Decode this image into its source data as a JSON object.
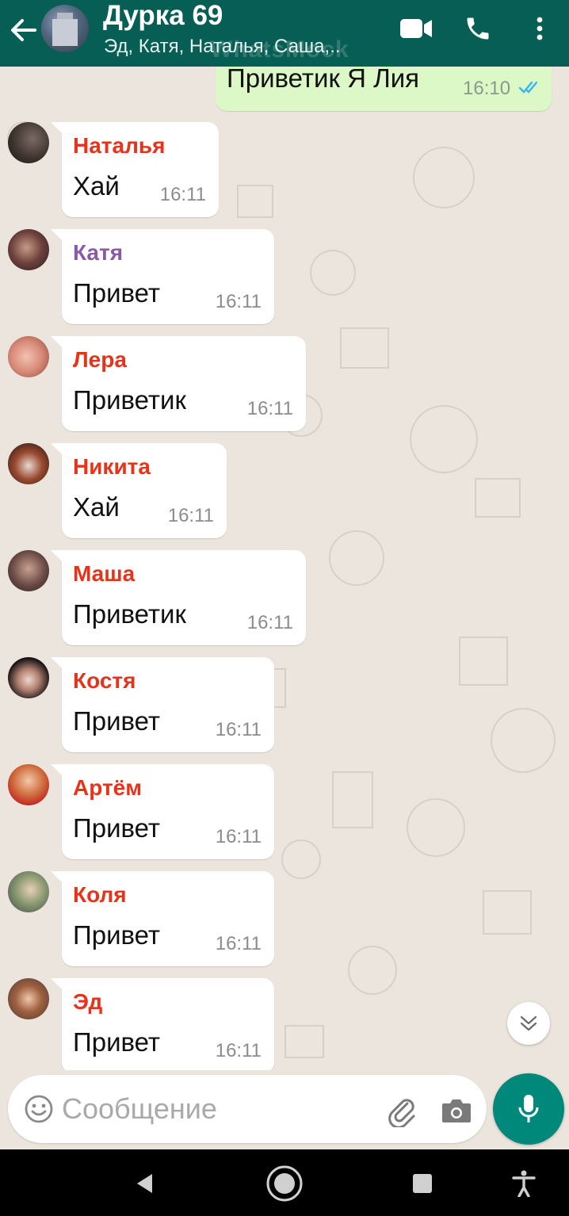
{
  "header": {
    "title": "Дурка 69",
    "subtitle": "Эд, Катя, Наталья, Саша,..",
    "watermark": "WhatsMock",
    "back_icon": "arrow-left-icon",
    "video_icon": "video-call-icon",
    "call_icon": "phone-icon",
    "menu_icon": "more-vert-icon"
  },
  "outgoing": {
    "text": "Приветик Я Лия",
    "time": "16:10",
    "status_icon": "double-check-icon"
  },
  "messages": [
    {
      "sender": "Наталья",
      "text": "Хай",
      "time": "16:11",
      "color": "#e8331b"
    },
    {
      "sender": "Катя",
      "text": "Привет",
      "time": "16:11",
      "color": "#8e58a8"
    },
    {
      "sender": "Лера",
      "text": "Приветик",
      "time": "16:11",
      "color": "#e8331b"
    },
    {
      "sender": "Никита",
      "text": "Хай",
      "time": "16:11",
      "color": "#e8331b"
    },
    {
      "sender": "Маша",
      "text": "Приветик",
      "time": "16:11",
      "color": "#e8331b"
    },
    {
      "sender": "Костя",
      "text": "Привет",
      "time": "16:11",
      "color": "#e8331b"
    },
    {
      "sender": "Артём",
      "text": "Привет",
      "time": "16:11",
      "color": "#e8331b"
    },
    {
      "sender": "Коля",
      "text": "Привет",
      "time": "16:11",
      "color": "#e8331b"
    },
    {
      "sender": "Эд",
      "text": "Привет",
      "time": "16:11",
      "color": "#e8331b"
    }
  ],
  "composer": {
    "placeholder": "Сообщение",
    "emoji_icon": "emoji-icon",
    "attach_icon": "paperclip-icon",
    "camera_icon": "camera-icon",
    "mic_icon": "microphone-icon"
  },
  "colors": {
    "header_bg": "#075e54",
    "chat_bg": "#ece5dd",
    "outgoing_bubble": "#dcf8c6",
    "accent": "#00897b",
    "read_ticks": "#34b7f1"
  }
}
